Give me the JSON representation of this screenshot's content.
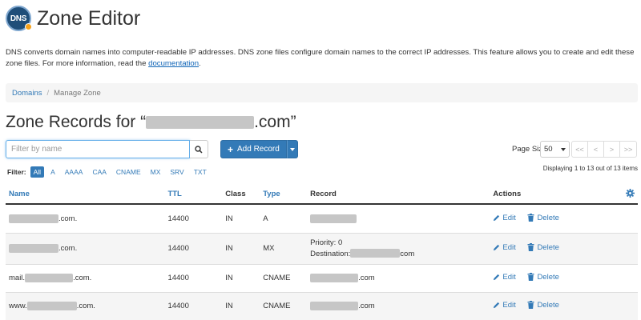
{
  "header": {
    "logo_text": "DNS",
    "title": "Zone Editor"
  },
  "description": {
    "text": "DNS converts domain names into computer-readable IP addresses. DNS zone files configure domain names to the correct IP addresses. This feature allows you to create and edit these zone files. For more information, read the ",
    "link": "documentation",
    "end": "."
  },
  "breadcrumb": {
    "root": "Domains",
    "separator": "/",
    "current": "Manage Zone"
  },
  "zone": {
    "title_prefix": "Zone Records for “",
    "title_suffix": ".com”"
  },
  "search": {
    "placeholder": "Filter by name",
    "icon": "search-icon"
  },
  "add_record": {
    "label": "Add Record",
    "plus": "+"
  },
  "pager": {
    "label": "Page Size",
    "size": "50",
    "buttons": [
      "<<",
      "<",
      ">",
      ">>"
    ],
    "displaying": "Displaying 1 to 13 out of 13 items"
  },
  "filter": {
    "label": "Filter:",
    "options": [
      "All",
      "A",
      "AAAA",
      "CAA",
      "CNAME",
      "MX",
      "SRV",
      "TXT"
    ],
    "active": "All"
  },
  "table": {
    "headers": {
      "name": "Name",
      "ttl": "TTL",
      "class": "Class",
      "type": "Type",
      "record": "Record",
      "actions": "Actions"
    },
    "action_labels": {
      "edit": "Edit",
      "delete": "Delete"
    },
    "rows": [
      {
        "name_prefix": "",
        "name_suffix": ".com.",
        "ttl": "14400",
        "class": "IN",
        "type": "A",
        "record_prefix": "",
        "record_suffix": ""
      },
      {
        "name_prefix": "",
        "name_suffix": ".com.",
        "ttl": "14400",
        "class": "IN",
        "type": "MX",
        "priority_label": "Priority: 0",
        "destination_label": "Destination:",
        "record_suffix": "com"
      },
      {
        "name_prefix": "mail.",
        "name_suffix": ".com.",
        "ttl": "14400",
        "class": "IN",
        "type": "CNAME",
        "record_prefix": "",
        "record_suffix": ".com"
      },
      {
        "name_prefix": "www.",
        "name_suffix": ".com.",
        "ttl": "14400",
        "class": "IN",
        "type": "CNAME",
        "record_prefix": "",
        "record_suffix": ".com"
      }
    ]
  },
  "colors": {
    "accent": "#337ab7",
    "logo_bg": "#1f4e79",
    "logo_dot": "#f7a21b"
  }
}
